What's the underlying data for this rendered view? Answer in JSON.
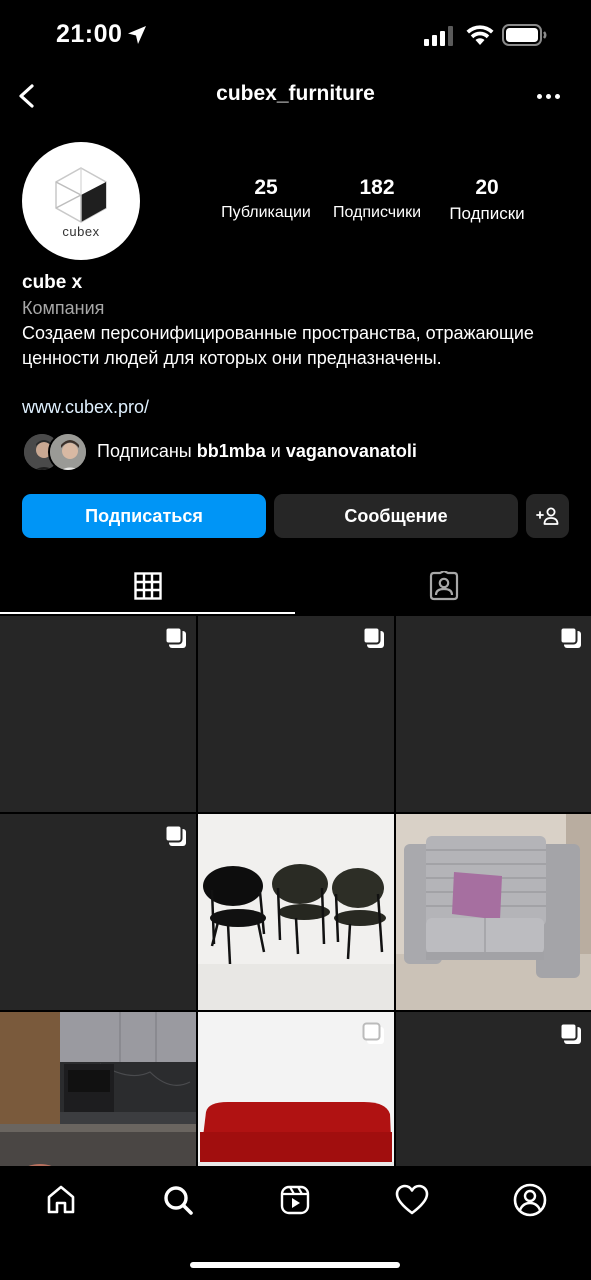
{
  "status_bar": {
    "time": "21:00"
  },
  "header": {
    "username": "cubex_furniture"
  },
  "profile": {
    "avatar_text": "cubex",
    "stats": [
      {
        "value": "25",
        "label": "Публикации"
      },
      {
        "value": "182",
        "label": "Подписчики"
      },
      {
        "value": "20",
        "label": "Подписки"
      }
    ],
    "name": "cube x",
    "category": "Компания",
    "bio": "Создаем персонифицированные пространства, отражающие ценности людей для которых они предназначены.",
    "website": "www.cubex.pro/",
    "followed_by": {
      "prefix": "Подписаны",
      "user1": "bb1mba",
      "conjunction": "и",
      "user2": "vaganovanatoli"
    }
  },
  "buttons": {
    "follow": "Подписаться",
    "message": "Сообщение"
  },
  "tabs": {
    "active": "posts-grid",
    "items": [
      "posts-grid-icon",
      "tagged-icon"
    ]
  },
  "grid": {
    "posts": [
      {
        "kind": "dark",
        "multi": true
      },
      {
        "kind": "dark",
        "multi": true
      },
      {
        "kind": "dark",
        "multi": true
      },
      {
        "kind": "dark",
        "multi": true
      },
      {
        "kind": "chairs",
        "multi": false
      },
      {
        "kind": "sofa-booth",
        "multi": false
      },
      {
        "kind": "kitchen",
        "multi": false
      },
      {
        "kind": "red-sofa",
        "multi": true
      },
      {
        "kind": "dark",
        "multi": true
      }
    ]
  },
  "bottom_nav": {
    "items": [
      "home-icon",
      "search-icon",
      "reels-icon",
      "heart-icon",
      "profile-icon"
    ],
    "active": "search-icon"
  },
  "colors": {
    "background": "#000000",
    "accent": "#0095f6",
    "secondary_button": "#262626",
    "muted_text": "#a8a8a8",
    "link": "#e0f1ff"
  }
}
